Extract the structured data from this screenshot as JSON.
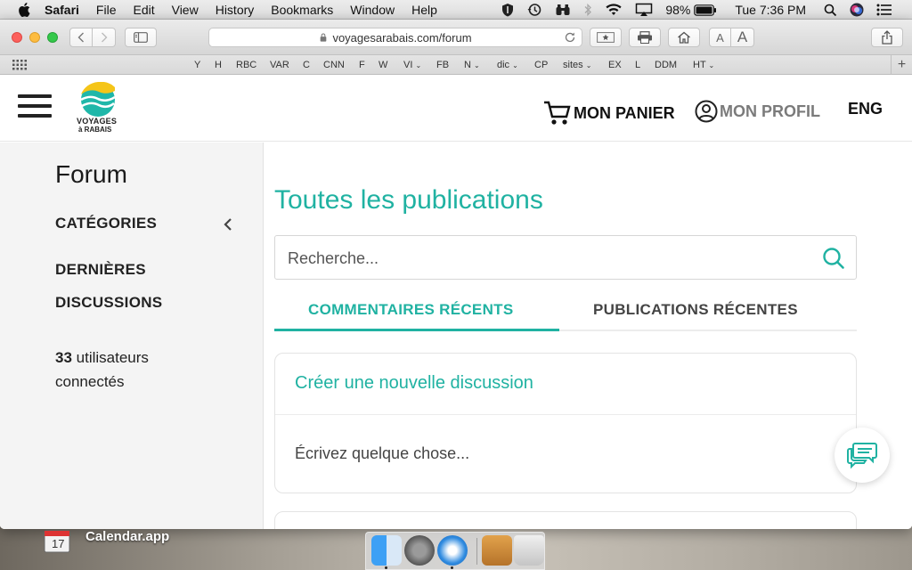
{
  "menubar": {
    "app": "Safari",
    "items": [
      "File",
      "Edit",
      "View",
      "History",
      "Bookmarks",
      "Window",
      "Help"
    ],
    "battery": "98%",
    "clock": "Tue 7:36 PM"
  },
  "browser": {
    "url": "voyagesarabais.com/forum",
    "text_small": "A",
    "text_large": "A",
    "bookmarks": [
      "Y",
      "H",
      "RBC",
      "VAR",
      "C",
      "CNN",
      "F",
      "W",
      "VI",
      "FB",
      "N",
      "dic",
      "CP",
      "sites",
      "EX",
      "L",
      "DDM",
      "HT"
    ]
  },
  "header": {
    "logo_line1": "VOYAGES",
    "logo_line2": "à RABAIS",
    "cart_label": "MON PANIER",
    "profile_label": "MON PROFIL",
    "lang_label": "ENG"
  },
  "sidebar": {
    "title": "Forum",
    "categories_label": "CATÉGORIES",
    "latest_label": "DERNIÈRES",
    "discussions_label": "DISCUSSIONS",
    "users_count": "33",
    "users_label": "utilisateurs",
    "users_label2": "connectés"
  },
  "main": {
    "title": "Toutes les publications",
    "search_placeholder": "Recherche...",
    "tab_recent_comments": "COMMENTAIRES RÉCENTS",
    "tab_recent_posts": "PUBLICATIONS RÉCENTES",
    "new_discussion_title": "Créer une nouvelle discussion",
    "new_discussion_placeholder": "Écrivez quelque chose..."
  },
  "desktop": {
    "calendar_day": "17",
    "calendar_label": "Calendar.app"
  },
  "colors": {
    "accent": "#20b2a2"
  }
}
